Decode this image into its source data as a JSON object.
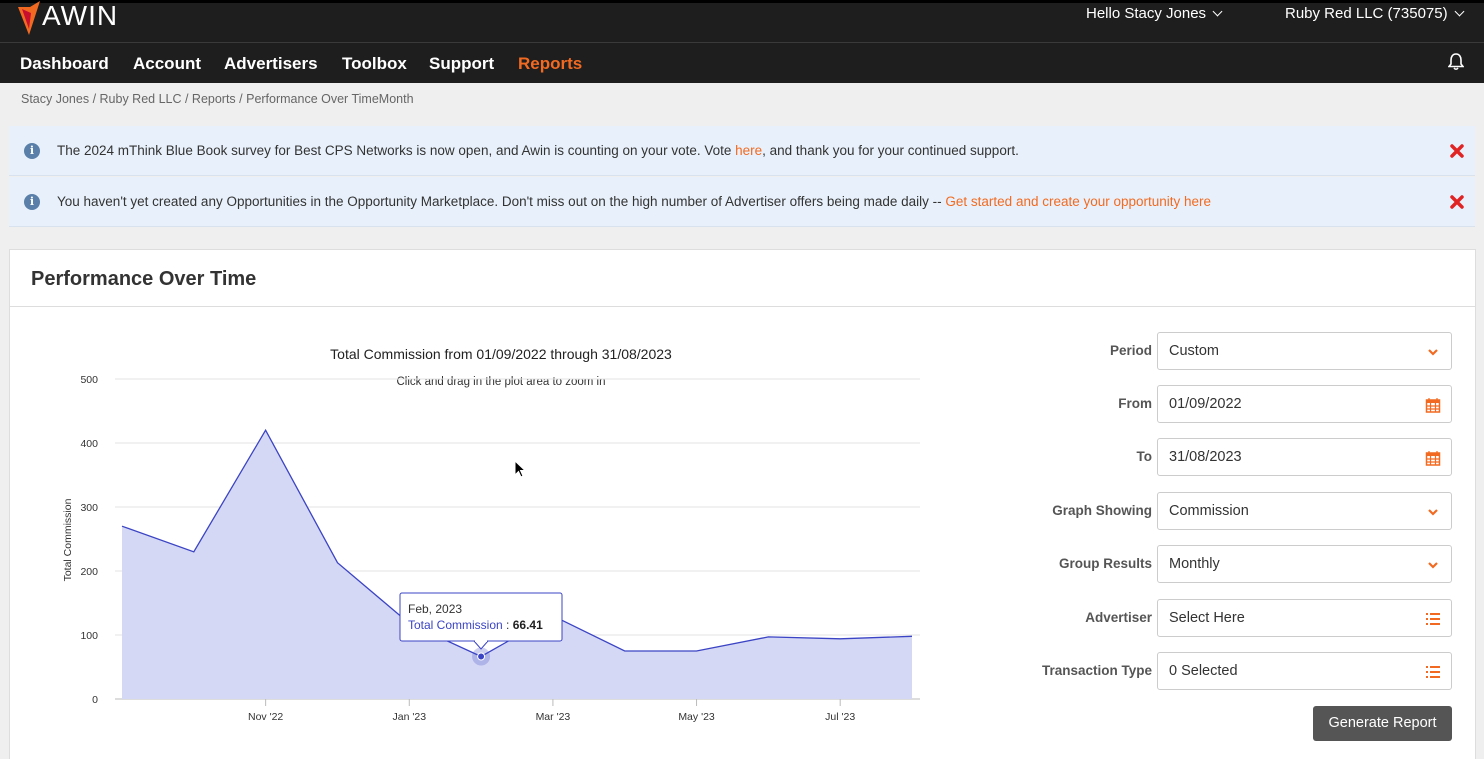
{
  "header": {
    "logo_text": "AWIN",
    "greeting": "Hello Stacy Jones",
    "account": "Ruby Red LLC (735075)"
  },
  "nav": {
    "items": [
      {
        "label": "Dashboard"
      },
      {
        "label": "Account"
      },
      {
        "label": "Advertisers"
      },
      {
        "label": "Toolbox"
      },
      {
        "label": "Support"
      },
      {
        "label": "Reports"
      }
    ],
    "active": "Reports"
  },
  "breadcrumb": "Stacy Jones / Ruby Red LLC / Reports / Performance Over TimeMonth",
  "notices": [
    {
      "text_before": "The 2024 mThink Blue Book survey for Best CPS Networks is now open, and Awin is counting on your vote. Vote ",
      "link": "here",
      "text_after": ", and thank you for your continued support."
    },
    {
      "text_before": "You haven't yet created any Opportunities in the Opportunity Marketplace. Don't miss out on the high number of Advertiser offers being made daily -- ",
      "link": "Get started and create your opportunity here",
      "text_after": ""
    }
  ],
  "panel": {
    "title": "Performance Over Time"
  },
  "form": {
    "period_label": "Period",
    "period_value": "Custom",
    "from_label": "From",
    "from_value": "01/09/2022",
    "to_label": "To",
    "to_value": "31/08/2023",
    "graph_label": "Graph Showing",
    "graph_value": "Commission",
    "group_label": "Group Results",
    "group_value": "Monthly",
    "advertiser_label": "Advertiser",
    "advertiser_value": "Select Here",
    "txn_label": "Transaction Type",
    "txn_value": "0 Selected",
    "generate_label": "Generate Report"
  },
  "colors": {
    "accent": "#f26a21",
    "series_line": "#3b44c4",
    "series_fill": "#d5d8f5"
  },
  "chart_data": {
    "type": "area",
    "title": "Total Commission from 01/09/2022 through 31/08/2023",
    "subtitle": "Click and drag in the plot area to zoom in",
    "ylabel": "Total Commission",
    "xlabel": "",
    "ylim": [
      0,
      500
    ],
    "yticks": [
      0,
      100,
      200,
      300,
      400,
      500
    ],
    "x": [
      "2022-09",
      "2022-10",
      "2022-11",
      "2022-12",
      "2023-01",
      "2023-02",
      "2023-03",
      "2023-04",
      "2023-05",
      "2023-06",
      "2023-07",
      "2023-08"
    ],
    "xtick_labels": [
      {
        "month": "2022-11",
        "label": "Nov '22"
      },
      {
        "month": "2023-01",
        "label": "Jan '23"
      },
      {
        "month": "2023-03",
        "label": "Mar '23"
      },
      {
        "month": "2023-05",
        "label": "May '23"
      },
      {
        "month": "2023-07",
        "label": "Jul '23"
      }
    ],
    "series": [
      {
        "name": "Total Commission",
        "values": [
          270,
          230,
          420,
          213,
          118,
          66.41,
          130,
          75,
          75,
          97,
          94,
          98
        ]
      }
    ],
    "grid": true,
    "legend": "none",
    "tooltip": {
      "month": "2023-02",
      "title": "Feb, 2023",
      "series": "Total Commission",
      "value": "66.41"
    }
  }
}
